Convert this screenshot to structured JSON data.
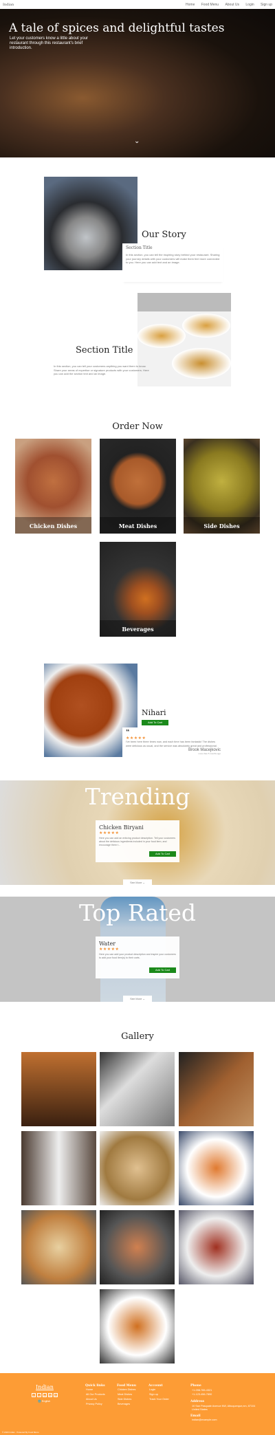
{
  "nav": {
    "brand": "Indian",
    "links": [
      "Home",
      "Food Menu",
      "About Us",
      "Login",
      "Sign up"
    ]
  },
  "hero": {
    "title": "A tale of spices and delightful tastes",
    "subtitle": "Let your customers know a little about your restaurant through this restaurant's brief introduction."
  },
  "story": {
    "heading": "Our Story",
    "title": "Section Title",
    "text": "In this section, you can tell the inspiring story behind your restaurant. Sharing your journey details with your customers will make them feel more connected to you. Here you can add text and an image."
  },
  "section2": {
    "title": "Section Title",
    "text": "In this section, you can tell your customers anything you want them to know. Share your areas of expertise or signature products with your customers. Here you can add the section text and an image."
  },
  "order": {
    "heading": "Order Now",
    "categories": [
      "Chicken Dishes",
      "Meat Dishes",
      "Side Dishes",
      "Beverages"
    ]
  },
  "featured": {
    "name": "Nihari",
    "button": "Add To Cart",
    "rating": 5,
    "review": "I've been here three times now, and each time has been fantastic! The dishes were delicious as usual, and the service was absolutely great and professional.",
    "reviewer": "Brook Macejkovic",
    "time": "more than 5 months ago"
  },
  "trending": {
    "heading": "Trending",
    "item": "Chicken Biryani",
    "rating": 5,
    "desc": "Here you can add an enticing product description. Tell your customers about the delicious ingredients included in your food item, and encourage them t...",
    "button": "Add To Cart",
    "see_more": "See More"
  },
  "top_rated": {
    "heading": "Top Rated",
    "item": "Water",
    "rating": 5,
    "desc": "Here you can add your product description and inspire your customers to add your food item(s) to their carts.",
    "button": "Add To Cart",
    "see_more": "See More"
  },
  "gallery": {
    "heading": "Gallery"
  },
  "footer": {
    "brand": "Indian",
    "language": "English",
    "quick_links": {
      "title": "Quick links",
      "items": [
        "Home",
        "All Our Products",
        "About Us",
        "Privacy Policy"
      ]
    },
    "food_menu": {
      "title": "Food Menu",
      "items": [
        "Chicken Dishes",
        "Meat Dishes",
        "Side Dishes",
        "Beverages"
      ]
    },
    "account": {
      "title": "Account",
      "items": [
        "Login",
        "Sign up",
        "Track Your Order"
      ]
    },
    "phone": {
      "title": "Phone",
      "items": [
        "+1-098-765-4321",
        "+1-123-456-7890"
      ]
    },
    "address": {
      "title": "Address",
      "text": "10 San Pasquale Avenue NW, Albuquerque,nm, 87104 United States"
    },
    "email": {
      "title": "Email",
      "text": "indian@example.com"
    },
    "copyright": "© 2023 Indian . Powered By Food Menu"
  },
  "colors": {
    "accent": "#fd9c35",
    "button": "#1b8a1b",
    "stars": "#f39237"
  }
}
